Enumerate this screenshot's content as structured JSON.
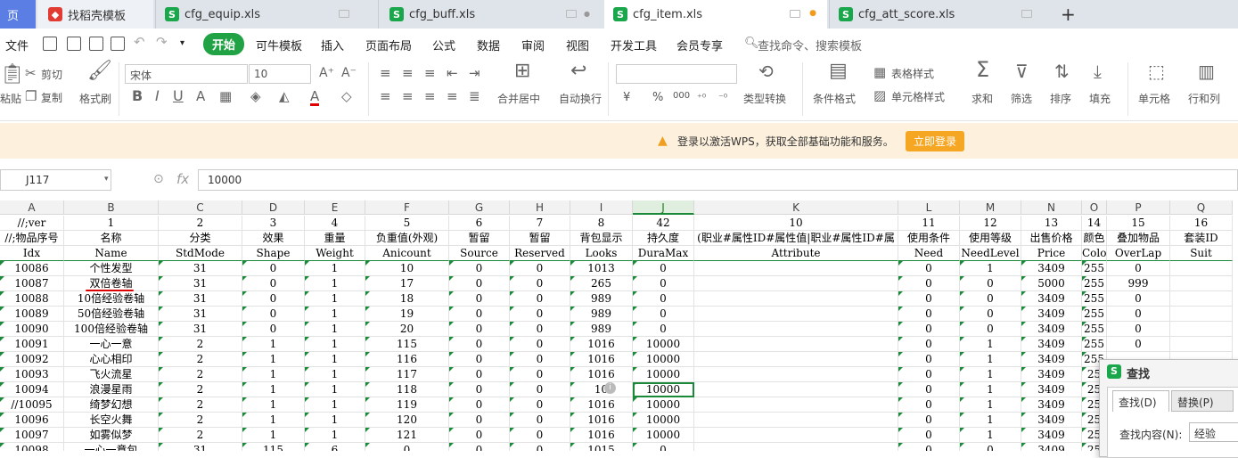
{
  "tabs": [
    {
      "label": "页",
      "icon": ""
    },
    {
      "label": "找稻壳模板",
      "icon": "r"
    },
    {
      "label": "cfg_equip.xls",
      "icon": "s"
    },
    {
      "label": "cfg_buff.xls",
      "icon": "s"
    },
    {
      "label": "cfg_item.xls",
      "icon": "s"
    },
    {
      "label": "cfg_att_score.xls",
      "icon": "s"
    }
  ],
  "tab_icon_letter": "S",
  "menu": {
    "file": "文件",
    "start": "开始",
    "items": [
      "可牛模板",
      "插入",
      "页面布局",
      "公式",
      "数据",
      "审阅",
      "视图",
      "开发工具",
      "会员专享"
    ],
    "search": "查找命令、搜索模板"
  },
  "ribbon": {
    "cut": "剪切",
    "copy": "复制",
    "paste": "粘贴",
    "format_painter": "格式刷",
    "font": "宋体",
    "size": "10",
    "merge": "合并居中",
    "wrap": "自动换行",
    "type_convert": "类型转换",
    "cond_format": "条件格式",
    "table_style": "表格样式",
    "cell_style": "单元格样式",
    "sum": "求和",
    "filter": "筛选",
    "sort": "排序",
    "fill": "填充",
    "cell": "单元格",
    "rowcol": "行和列",
    "currency": "¥",
    "percent": "%",
    "thousand": "000"
  },
  "notice": {
    "text": "登录以激活WPS，获取全部基础功能和服务。",
    "button": "立即登录"
  },
  "formula": {
    "cellref": "J117",
    "fx": "fx",
    "value": "10000"
  },
  "columns": [
    "A",
    "B",
    "C",
    "D",
    "E",
    "F",
    "G",
    "H",
    "I",
    "J",
    "K",
    "L",
    "M",
    "N",
    "O",
    "P",
    "Q"
  ],
  "header_rows": [
    [
      "//;ver",
      "1",
      "2",
      "3",
      "4",
      "5",
      "6",
      "7",
      "8",
      "42",
      "10",
      "11",
      "12",
      "13",
      "14",
      "15",
      "16"
    ],
    [
      "//;物品序号",
      "名称",
      "分类",
      "效果",
      "重量",
      "负重值(外观)",
      "暂留",
      "暂留",
      "背包显示",
      "持久度",
      "(职业#属性ID#属性值|职业#属性ID#属",
      "使用条件",
      "使用等级",
      "出售价格",
      "颜色",
      "叠加物品",
      "套装ID"
    ],
    [
      "Idx",
      "Name",
      "StdMode",
      "Shape",
      "Weight",
      "Anicount",
      "Source",
      "Reserved",
      "Looks",
      "DuraMax",
      "Attribute",
      "Need",
      "NeedLevel",
      "Price",
      "Color",
      "OverLap",
      "Suit"
    ]
  ],
  "rows": [
    [
      "10086",
      "个性发型",
      "31",
      "0",
      "1",
      "10",
      "0",
      "0",
      "1013",
      "0",
      "",
      "0",
      "1",
      "3409",
      "255",
      "0",
      ""
    ],
    [
      "10087",
      "双倍卷轴",
      "31",
      "0",
      "1",
      "17",
      "0",
      "0",
      "265",
      "0",
      "",
      "0",
      "0",
      "5000",
      "255",
      "999",
      ""
    ],
    [
      "10088",
      "10倍经验卷轴",
      "31",
      "0",
      "1",
      "18",
      "0",
      "0",
      "989",
      "0",
      "",
      "0",
      "0",
      "3409",
      "255",
      "0",
      ""
    ],
    [
      "10089",
      "50倍经验卷轴",
      "31",
      "0",
      "1",
      "19",
      "0",
      "0",
      "989",
      "0",
      "",
      "0",
      "0",
      "3409",
      "255",
      "0",
      ""
    ],
    [
      "10090",
      "100倍经验卷轴",
      "31",
      "0",
      "1",
      "20",
      "0",
      "0",
      "989",
      "0",
      "",
      "0",
      "0",
      "3409",
      "255",
      "0",
      ""
    ],
    [
      "10091",
      "一心一意",
      "2",
      "1",
      "1",
      "115",
      "0",
      "0",
      "1016",
      "10000",
      "",
      "0",
      "1",
      "3409",
      "255",
      "0",
      ""
    ],
    [
      "10092",
      "心心相印",
      "2",
      "1",
      "1",
      "116",
      "0",
      "0",
      "1016",
      "10000",
      "",
      "0",
      "1",
      "3409",
      "255",
      "",
      ""
    ],
    [
      "10093",
      "飞火流星",
      "2",
      "1",
      "1",
      "117",
      "0",
      "0",
      "1016",
      "10000",
      "",
      "0",
      "1",
      "3409",
      "25",
      "",
      ""
    ],
    [
      "10094",
      "浪漫星雨",
      "2",
      "1",
      "1",
      "118",
      "0",
      "0",
      "10",
      "10000",
      "",
      "0",
      "1",
      "3409",
      "25",
      "",
      ""
    ],
    [
      "//10095",
      "绮梦幻想",
      "2",
      "1",
      "1",
      "119",
      "0",
      "0",
      "1016",
      "10000",
      "",
      "0",
      "1",
      "3409",
      "25",
      "",
      ""
    ],
    [
      "10096",
      "长空火舞",
      "2",
      "1",
      "1",
      "120",
      "0",
      "0",
      "1016",
      "10000",
      "",
      "0",
      "1",
      "3409",
      "25",
      "",
      ""
    ],
    [
      "10097",
      "如雾似梦",
      "2",
      "1",
      "1",
      "121",
      "0",
      "0",
      "1016",
      "10000",
      "",
      "0",
      "1",
      "3409",
      "25",
      "",
      ""
    ],
    [
      "10098",
      "一心一意包",
      "31",
      "115",
      "6",
      "0",
      "0",
      "0",
      "1015",
      "0",
      "",
      "0",
      "0",
      "3409",
      "25",
      "",
      ""
    ]
  ],
  "find_dialog": {
    "title": "查找",
    "tab_find": "查找(D)",
    "tab_replace": "替换(P)",
    "label": "查找内容(N):",
    "value": "经验"
  },
  "colors": {
    "accent": "#1a8a3a",
    "start_btn": "#21a345",
    "login_btn": "#f5a623",
    "notice_bg": "#fdf1de"
  }
}
